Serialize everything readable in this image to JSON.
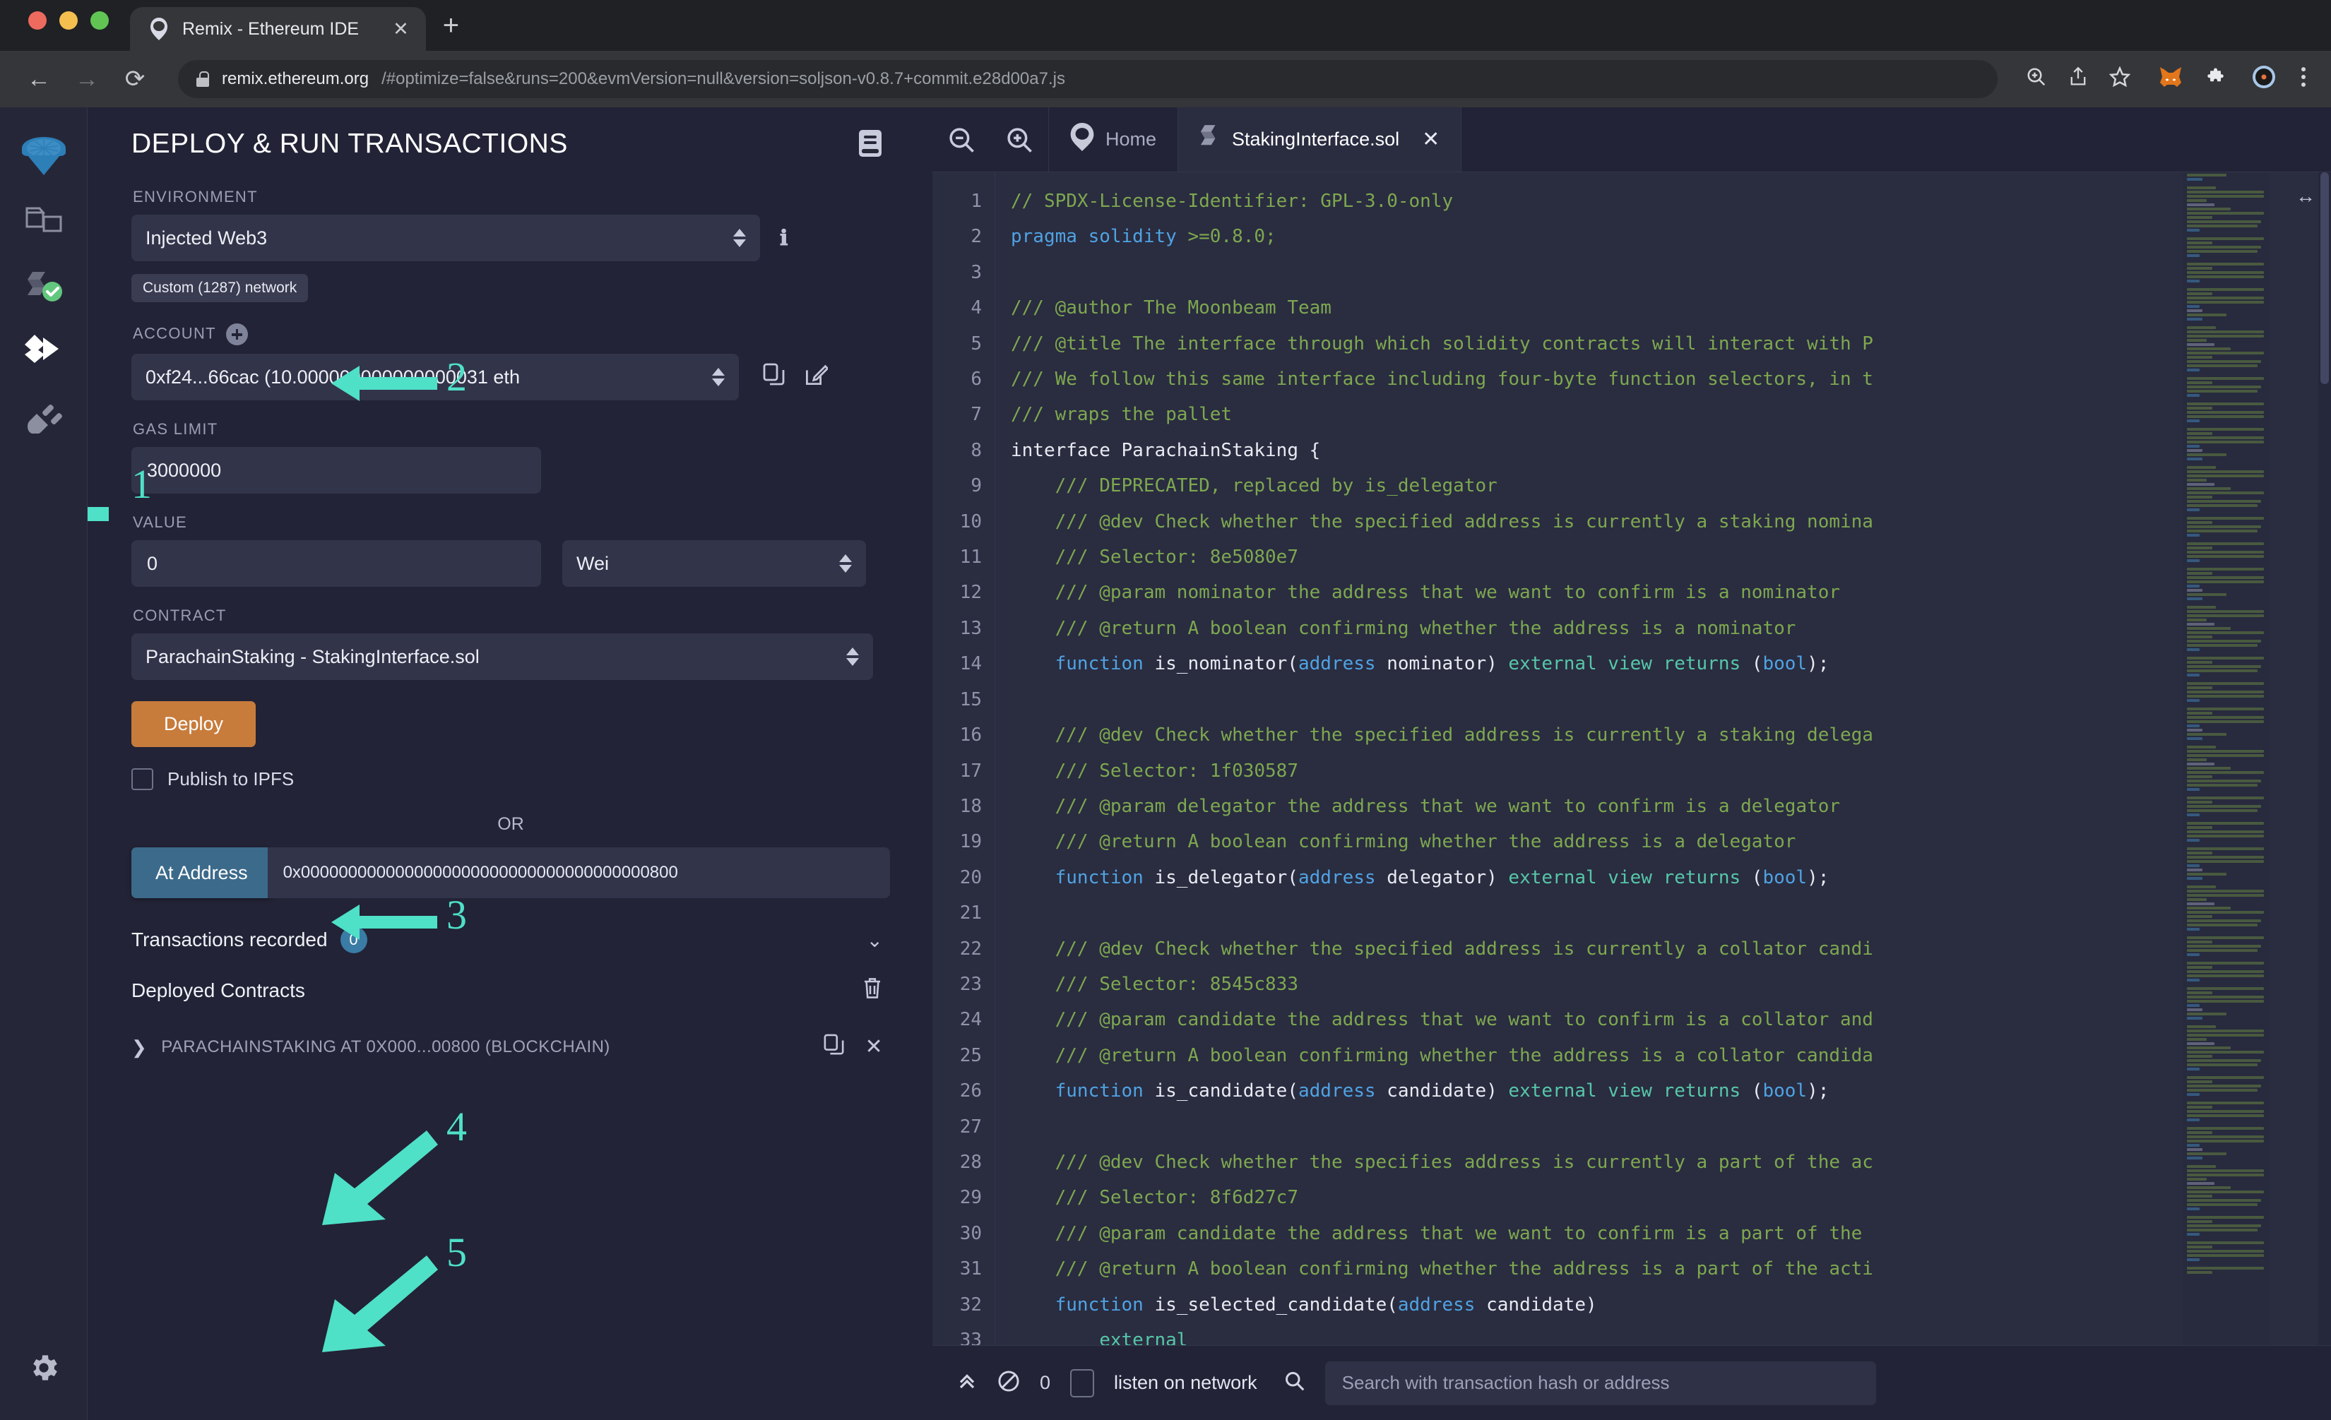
{
  "browser": {
    "tab_title": "Remix - Ethereum IDE",
    "tab_favicon": "remix-logo-icon",
    "close_label": "✕",
    "newtab_label": "+",
    "back_label": "←",
    "forward_label": "→",
    "reload_label": "⟳",
    "url_domain": "remix.ethereum.org",
    "url_path": "/#optimize=false&runs=200&evmVersion=null&version=soljson-v0.8.7+commit.e28d00a7.js",
    "toolbar_icons": [
      "zoom-in-icon",
      "share-icon",
      "bookmark-star-icon",
      "metamask-fox-icon",
      "extensions-puzzle-icon",
      "profile-avatar-icon",
      "browser-menu-icon"
    ]
  },
  "rail": {
    "items": [
      {
        "name": "remix-home-icon",
        "label": "Home"
      },
      {
        "name": "file-explorer-icon",
        "label": "File explorers"
      },
      {
        "name": "solidity-compiler-icon",
        "label": "Solidity compiler"
      },
      {
        "name": "deploy-run-icon",
        "label": "Deploy & run transactions"
      },
      {
        "name": "plugin-manager-icon",
        "label": "Plugin manager"
      }
    ],
    "settings_label": "Settings"
  },
  "panel": {
    "title": "DEPLOY & RUN TRANSACTIONS",
    "doc_icon": "book-icon",
    "environment": {
      "label": "ENVIRONMENT",
      "value": "Injected Web3",
      "network_badge": "Custom (1287) network",
      "info_icon": "info-icon"
    },
    "account": {
      "label": "ACCOUNT",
      "add_icon": "plus-circle-icon",
      "value": "0xf24...66cac (10.000000000000000031 eth",
      "copy_icon": "copy-icon",
      "edit_icon": "edit-icon"
    },
    "gas_limit": {
      "label": "GAS LIMIT",
      "value": "3000000"
    },
    "value_field": {
      "label": "VALUE",
      "value": "0",
      "unit": "Wei"
    },
    "contract": {
      "label": "CONTRACT",
      "value": "ParachainStaking - StakingInterface.sol"
    },
    "deploy_label": "Deploy",
    "publish_ipfs_label": "Publish to IPFS",
    "or_label": "OR",
    "at_address_label": "At Address",
    "at_address_value": "0x0000000000000000000000000000000000000800",
    "transactions_recorded_label": "Transactions recorded",
    "transactions_recorded_count": "0",
    "transactions_chevron": "chevron-down-icon",
    "deployed_contracts_label": "Deployed Contracts",
    "trash_icon": "trash-icon",
    "deployed_item": {
      "caret": "chevron-right-icon",
      "label": "PARACHAINSTAKING AT 0X000...00800 (BLOCKCHAIN)",
      "copy_icon": "copy-icon",
      "close_icon": "close-icon"
    },
    "annotations": [
      {
        "number": "1",
        "target": "deploy-run-rail-icon"
      },
      {
        "number": "2",
        "target": "environment-select"
      },
      {
        "number": "3",
        "target": "contract-select"
      },
      {
        "number": "4",
        "target": "at-address-input"
      },
      {
        "number": "5",
        "target": "deployed-contracts"
      }
    ],
    "annotation_color": "#4FE0C8"
  },
  "editor": {
    "zoom_out_icon": "zoom-out-icon",
    "zoom_in_icon": "zoom-in-icon",
    "tabs": [
      {
        "label": "Home",
        "icon": "remix-logo-icon",
        "active": false,
        "closable": false
      },
      {
        "label": "StakingInterface.sol",
        "icon": "solidity-file-icon",
        "active": true,
        "closable": true
      }
    ],
    "close_label": "✕",
    "resize_icon": "horizontal-resize-icon",
    "lines": [
      {
        "n": 1,
        "segs": [
          {
            "t": "// SPDX-License-Identifier: GPL-3.0-only",
            "c": "cm"
          }
        ]
      },
      {
        "n": 2,
        "segs": [
          {
            "t": "pragma solidity ",
            "c": "kw"
          },
          {
            "t": ">=0.8.0;",
            "c": "cm"
          }
        ]
      },
      {
        "n": 3,
        "segs": []
      },
      {
        "n": 4,
        "segs": [
          {
            "t": "/// @author The Moonbeam Team",
            "c": "cm"
          }
        ]
      },
      {
        "n": 5,
        "segs": [
          {
            "t": "/// @title The interface through which solidity contracts will interact with P",
            "c": "cm"
          }
        ]
      },
      {
        "n": 6,
        "segs": [
          {
            "t": "/// We follow this same interface including four-byte function selectors, in t",
            "c": "cm"
          }
        ]
      },
      {
        "n": 7,
        "segs": [
          {
            "t": "/// wraps the pallet",
            "c": "cm"
          }
        ]
      },
      {
        "n": 8,
        "segs": [
          {
            "t": "interface ParachainStaking {",
            "c": "fn"
          }
        ]
      },
      {
        "n": 9,
        "segs": [
          {
            "t": "    /// DEPRECATED, replaced by is_delegator",
            "c": "cm"
          }
        ]
      },
      {
        "n": 10,
        "segs": [
          {
            "t": "    /// @dev Check whether the specified address is currently a staking nomina",
            "c": "cm"
          }
        ]
      },
      {
        "n": 11,
        "segs": [
          {
            "t": "    /// Selector: 8e5080e7",
            "c": "cm"
          }
        ]
      },
      {
        "n": 12,
        "segs": [
          {
            "t": "    /// @param nominator the address that we want to confirm is a nominator",
            "c": "cm"
          }
        ]
      },
      {
        "n": 13,
        "segs": [
          {
            "t": "    /// @return A boolean confirming whether the address is a nominator",
            "c": "cm"
          }
        ]
      },
      {
        "n": 14,
        "segs": [
          {
            "t": "    function ",
            "c": "kw"
          },
          {
            "t": "is_nominator(",
            "c": "fn"
          },
          {
            "t": "address",
            "c": "ty"
          },
          {
            "t": " nominator) ",
            "c": "fn"
          },
          {
            "t": "external view returns ",
            "c": "kw2"
          },
          {
            "t": "(",
            "c": "fn"
          },
          {
            "t": "bool",
            "c": "ty"
          },
          {
            "t": ");",
            "c": "fn"
          }
        ]
      },
      {
        "n": 15,
        "segs": []
      },
      {
        "n": 16,
        "segs": [
          {
            "t": "    /// @dev Check whether the specified address is currently a staking delega",
            "c": "cm"
          }
        ]
      },
      {
        "n": 17,
        "segs": [
          {
            "t": "    /// Selector: 1f030587",
            "c": "cm"
          }
        ]
      },
      {
        "n": 18,
        "segs": [
          {
            "t": "    /// @param delegator the address that we want to confirm is a delegator",
            "c": "cm"
          }
        ]
      },
      {
        "n": 19,
        "segs": [
          {
            "t": "    /// @return A boolean confirming whether the address is a delegator",
            "c": "cm"
          }
        ]
      },
      {
        "n": 20,
        "segs": [
          {
            "t": "    function ",
            "c": "kw"
          },
          {
            "t": "is_delegator(",
            "c": "fn"
          },
          {
            "t": "address",
            "c": "ty"
          },
          {
            "t": " delegator) ",
            "c": "fn"
          },
          {
            "t": "external view returns ",
            "c": "kw2"
          },
          {
            "t": "(",
            "c": "fn"
          },
          {
            "t": "bool",
            "c": "ty"
          },
          {
            "t": ");",
            "c": "fn"
          }
        ]
      },
      {
        "n": 21,
        "segs": []
      },
      {
        "n": 22,
        "segs": [
          {
            "t": "    /// @dev Check whether the specified address is currently a collator candi",
            "c": "cm"
          }
        ]
      },
      {
        "n": 23,
        "segs": [
          {
            "t": "    /// Selector: 8545c833",
            "c": "cm"
          }
        ]
      },
      {
        "n": 24,
        "segs": [
          {
            "t": "    /// @param candidate the address that we want to confirm is a collator and",
            "c": "cm"
          }
        ]
      },
      {
        "n": 25,
        "segs": [
          {
            "t": "    /// @return A boolean confirming whether the address is a collator candida",
            "c": "cm"
          }
        ]
      },
      {
        "n": 26,
        "segs": [
          {
            "t": "    function ",
            "c": "kw"
          },
          {
            "t": "is_candidate(",
            "c": "fn"
          },
          {
            "t": "address",
            "c": "ty"
          },
          {
            "t": " candidate) ",
            "c": "fn"
          },
          {
            "t": "external view returns ",
            "c": "kw2"
          },
          {
            "t": "(",
            "c": "fn"
          },
          {
            "t": "bool",
            "c": "ty"
          },
          {
            "t": ");",
            "c": "fn"
          }
        ]
      },
      {
        "n": 27,
        "segs": []
      },
      {
        "n": 28,
        "segs": [
          {
            "t": "    /// @dev Check whether the specifies address is currently a part of the ac",
            "c": "cm"
          }
        ]
      },
      {
        "n": 29,
        "segs": [
          {
            "t": "    /// Selector: 8f6d27c7",
            "c": "cm"
          }
        ]
      },
      {
        "n": 30,
        "segs": [
          {
            "t": "    /// @param candidate the address that we want to confirm is a part of the ",
            "c": "cm"
          }
        ]
      },
      {
        "n": 31,
        "segs": [
          {
            "t": "    /// @return A boolean confirming whether the address is a part of the acti",
            "c": "cm"
          }
        ]
      },
      {
        "n": 32,
        "segs": [
          {
            "t": "    function ",
            "c": "kw"
          },
          {
            "t": "is_selected_candidate(",
            "c": "fn"
          },
          {
            "t": "address",
            "c": "ty"
          },
          {
            "t": " candidate)",
            "c": "fn"
          }
        ]
      },
      {
        "n": 33,
        "segs": [
          {
            "t": "        external",
            "c": "kw2"
          }
        ]
      }
    ]
  },
  "status": {
    "collapse_icon": "chevron-double-up-icon",
    "block_icon": "no-entry-icon",
    "count": "0",
    "listen_checkbox_label": "listen on network",
    "search_icon": "search-icon",
    "search_placeholder": "Search with transaction hash or address"
  }
}
